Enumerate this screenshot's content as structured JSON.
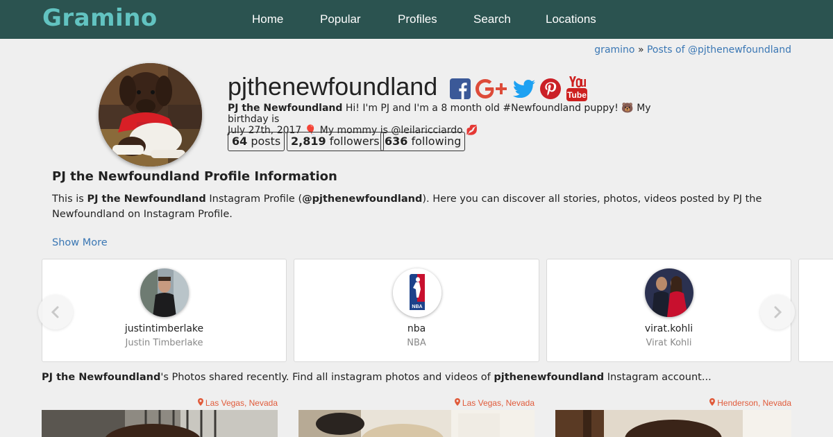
{
  "site": {
    "logo": "Gramino"
  },
  "nav": [
    {
      "label": "Home"
    },
    {
      "label": "Popular"
    },
    {
      "label": "Profiles"
    },
    {
      "label": "Search"
    },
    {
      "label": "Locations"
    }
  ],
  "breadcrumb": {
    "home": "gramino",
    "separator": "»",
    "current": "Posts of @pjthenewfoundland"
  },
  "profile": {
    "username": "pjthenewfoundland",
    "display_name": "PJ the Newfoundland",
    "bio_line1": " Hi! I'm PJ and I'm a 8 month old #Newfoundland puppy! ",
    "bio_emoji1": "🐻",
    "bio_line1b": " My birthday is",
    "bio_line2": "July 27th, 2017 ",
    "bio_emoji2": "🎈",
    "bio_line2b": " My mommy is @leilaricciardo ",
    "bio_emoji3": "💋",
    "stats": {
      "posts_value": "64",
      "posts_label": " posts",
      "followers_value": "2,819",
      "followers_label": " followers",
      "following_value": "636",
      "following_label": " following"
    },
    "social_icons": [
      "facebook-icon",
      "google-plus-icon",
      "twitter-icon",
      "pinterest-icon",
      "youtube-icon"
    ]
  },
  "info": {
    "title": "PJ the Newfoundland Profile Information",
    "text_a": "This is ",
    "text_b": "PJ the Newfoundland",
    "text_c": " Instagram Profile (",
    "text_d": "@pjthenewfoundland",
    "text_e": "). Here you can discover all stories, photos, videos posted by PJ the Newfoundland on Instagram Profile.",
    "show_more": "Show More"
  },
  "carousel": [
    {
      "username": "justintimberlake",
      "full_name": "Justin Timberlake"
    },
    {
      "username": "nba",
      "full_name": "NBA"
    },
    {
      "username": "virat.kohli",
      "full_name": "Virat Kohli"
    }
  ],
  "photos_intro": {
    "name": "PJ the Newfoundland",
    "text1": "'s Photos shared recently. Find all instagram photos and videos of ",
    "username": "pjthenewfoundland",
    "text2": " Instagram account..."
  },
  "photos": [
    {
      "location": "Las Vegas, Nevada"
    },
    {
      "location": "Las Vegas, Nevada"
    },
    {
      "location": "Henderson, Nevada"
    }
  ],
  "colors": {
    "navbar": "#2b5350",
    "logo": "#62c3c1",
    "link": "#3a77b4",
    "location": "#e05a3a",
    "facebook": "#3b5998",
    "google_plus": "#dd4b39",
    "twitter": "#1da1f2",
    "pinterest": "#cb2027",
    "youtube": "#cd201f"
  }
}
